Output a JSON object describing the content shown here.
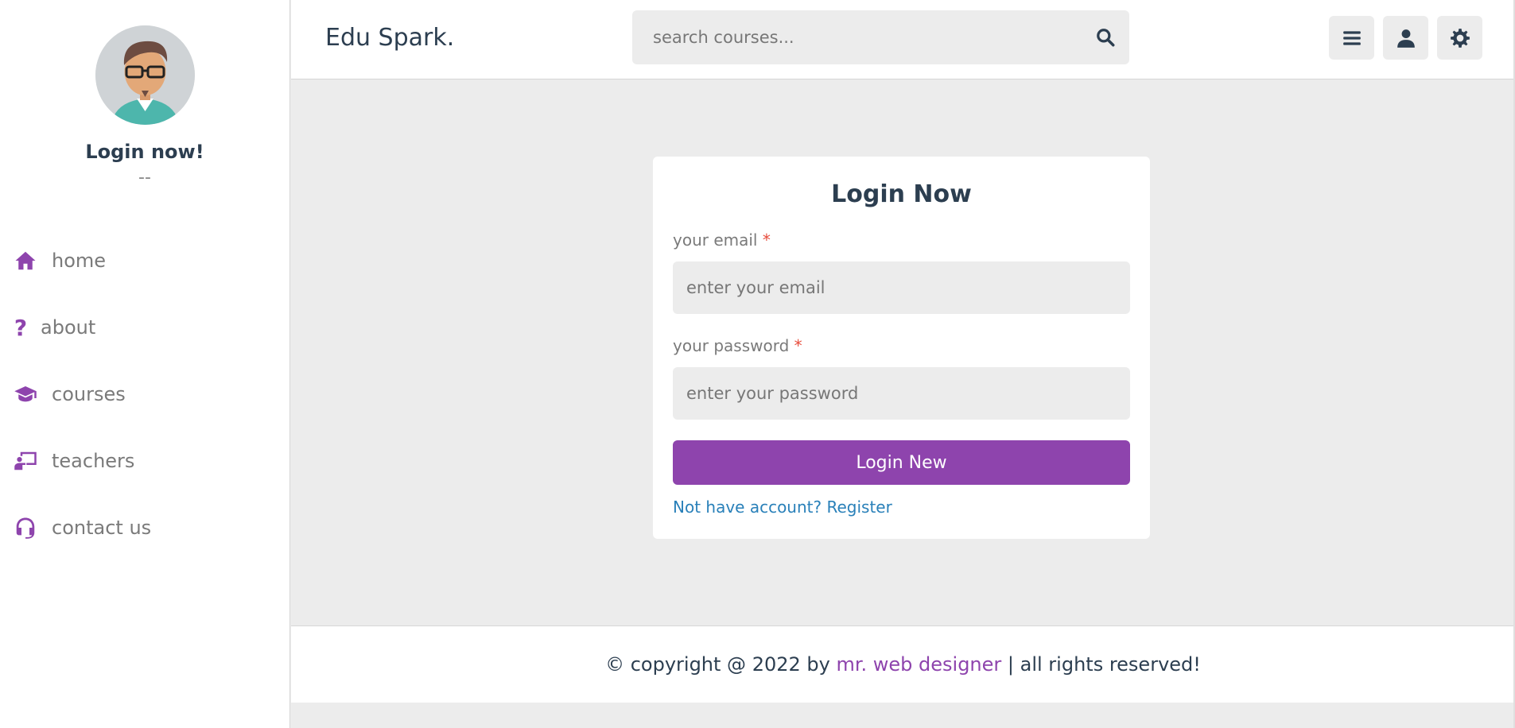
{
  "sidebar": {
    "profile": {
      "name": "Login now!",
      "role": "--"
    },
    "nav": [
      {
        "label": "home",
        "icon": "home-icon"
      },
      {
        "label": "about",
        "icon": "question-icon"
      },
      {
        "label": "courses",
        "icon": "graduation-cap-icon"
      },
      {
        "label": "teachers",
        "icon": "chalkboard-teacher-icon"
      },
      {
        "label": "contact us",
        "icon": "headset-icon"
      }
    ]
  },
  "header": {
    "logo": "Edu Spark.",
    "search": {
      "placeholder": "search courses...",
      "icon": "search-icon"
    },
    "buttons": [
      "menu-icon",
      "user-icon",
      "gear-icon"
    ]
  },
  "login": {
    "title": "Login Now",
    "email_label": "your email",
    "email_placeholder": "enter your email",
    "password_label": "your password",
    "password_placeholder": "enter your password",
    "required_mark": "*",
    "submit_label": "Login New",
    "register_text": "Not have account? Register"
  },
  "footer": {
    "prefix": "© copyright @ 2022 by ",
    "author": "mr. web designer",
    "suffix": " | all rights reserved!"
  },
  "colors": {
    "accent": "#8e44ad",
    "link": "#2980b9",
    "text": "#2c3e50",
    "required": "#e74c3c"
  }
}
